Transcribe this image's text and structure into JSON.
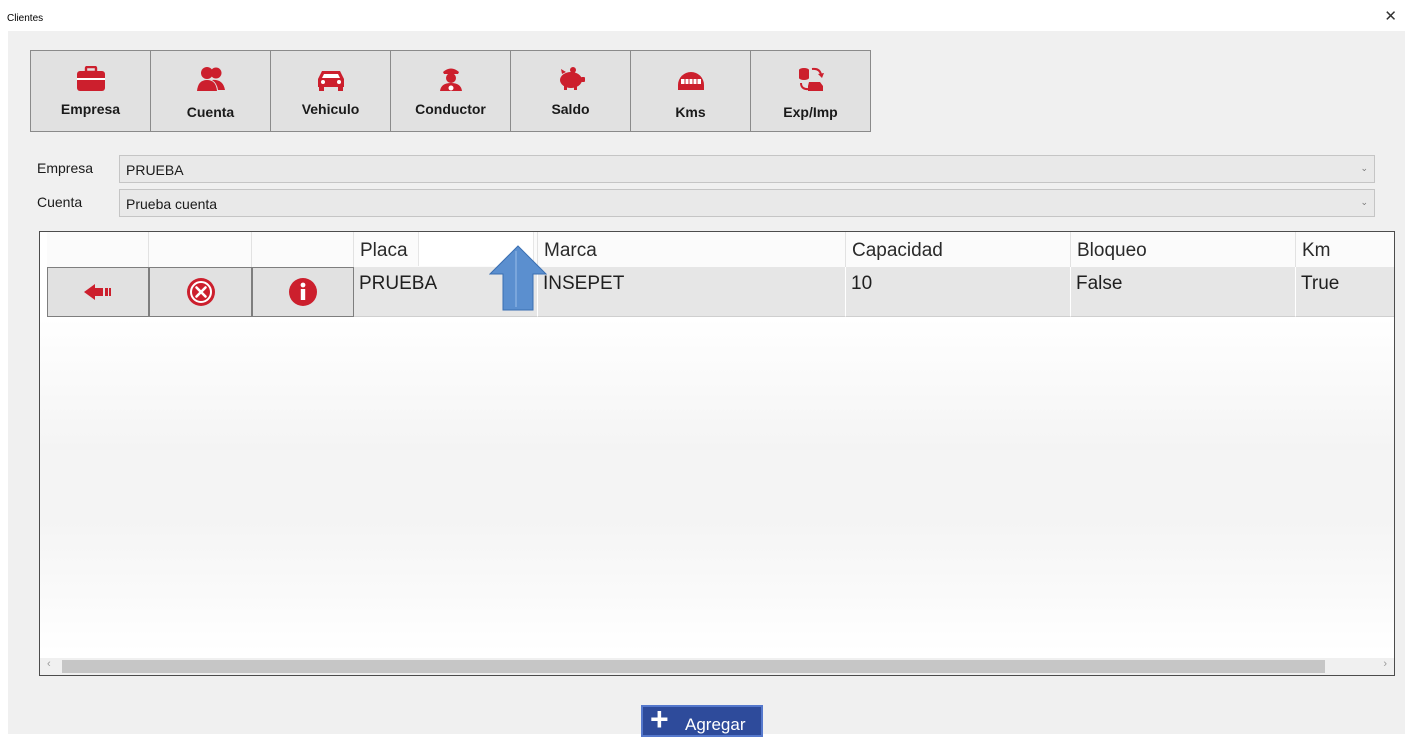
{
  "window": {
    "title": "Clientes",
    "close_glyph": "✕"
  },
  "toolbar": {
    "items": [
      {
        "label": "Empresa",
        "icon": "briefcase-icon"
      },
      {
        "label": "Cuenta",
        "icon": "users-icon"
      },
      {
        "label": "Vehiculo",
        "icon": "car-icon"
      },
      {
        "label": "Conductor",
        "icon": "driver-icon"
      },
      {
        "label": "Saldo",
        "icon": "piggy-bank-icon"
      },
      {
        "label": "Kms",
        "icon": "odometer-icon"
      },
      {
        "label": "Exp/Imp",
        "icon": "export-import-icon"
      }
    ]
  },
  "filters": {
    "empresa": {
      "label": "Empresa",
      "value": "PRUEBA"
    },
    "cuenta": {
      "label": "Cuenta",
      "value": "Prueba cuenta"
    },
    "dropdown_glyph": "⌄"
  },
  "grid": {
    "columns": [
      "Placa",
      "Marca",
      "Capacidad",
      "Bloqueo",
      "Km"
    ],
    "rows": [
      {
        "placa": "PRUEBA",
        "marca": "INSEPET",
        "capacidad": "10",
        "bloqueo": "False",
        "km": "True"
      }
    ],
    "scroll_left": "‹",
    "scroll_right": "›"
  },
  "actions": {
    "add_label": "Agregar",
    "add_glyph": "+"
  },
  "colors": {
    "icon_red": "#cc1f2d",
    "accent_blue": "#2e4b9b",
    "sort_arrow": "#5b8fcf"
  }
}
